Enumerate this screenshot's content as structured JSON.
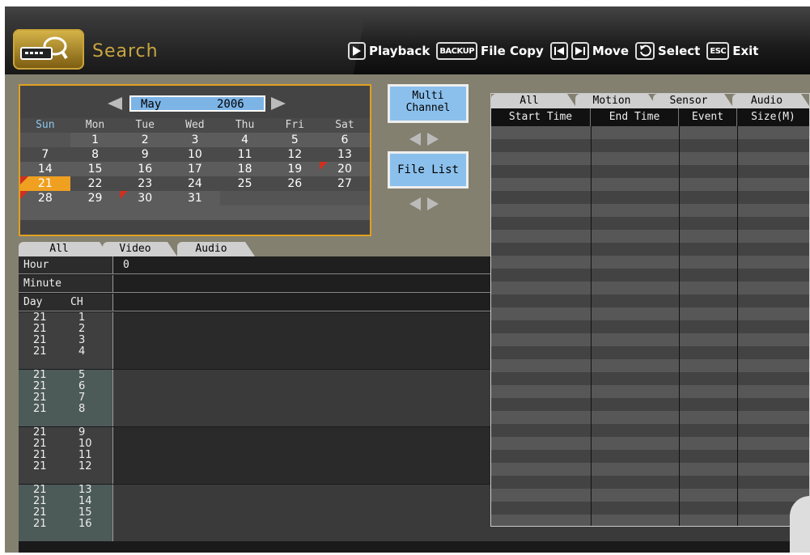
{
  "header": {
    "title": "Search",
    "legend": [
      {
        "icon": "play-icon",
        "label": "Playback"
      },
      {
        "icon": "backup-key-icon",
        "key": "BACKUP",
        "label": "File Copy"
      },
      {
        "icon": "skip-prev-icon",
        "label": ""
      },
      {
        "icon": "skip-next-icon",
        "label": "Move"
      },
      {
        "icon": "enter-icon",
        "label": "Select"
      },
      {
        "icon": "esc-key-icon",
        "key": "ESC",
        "label": "Exit"
      }
    ]
  },
  "calendar": {
    "month": "May",
    "year": "2006",
    "weekdays": [
      "Sun",
      "Mon",
      "Tue",
      "Wed",
      "Thu",
      "Fri",
      "Sat"
    ],
    "weeks": [
      [
        "",
        "1",
        "2",
        "3",
        "4",
        "5",
        "6"
      ],
      [
        "7",
        "8",
        "9",
        "10",
        "11",
        "12",
        "13"
      ],
      [
        "14",
        "15",
        "16",
        "17",
        "18",
        "19",
        "20"
      ],
      [
        "21",
        "22",
        "23",
        "24",
        "25",
        "26",
        "27"
      ],
      [
        "28",
        "29",
        "30",
        "31",
        "",
        "",
        ""
      ]
    ],
    "selected_day": "21",
    "recorded_days": [
      "20",
      "21",
      "28",
      "30"
    ],
    "colors": {
      "selected": "#f0a020",
      "month_bar": "#7cb4e6",
      "border": "#e0a020",
      "mark": "#d03020"
    }
  },
  "middle": {
    "multi_channel_line1": "Multi",
    "multi_channel_line2": "Channel",
    "file_list": "File List"
  },
  "left_tabs": [
    "All",
    "Video",
    "Audio"
  ],
  "timeline": {
    "hour_label": "Hour",
    "hour_value": "0",
    "minute_label": "Minute",
    "day_label": "Day",
    "ch_label": "CH",
    "rows": [
      {
        "day": "21",
        "ch": "1"
      },
      {
        "day": "21",
        "ch": "2"
      },
      {
        "day": "21",
        "ch": "3"
      },
      {
        "day": "21",
        "ch": "4"
      },
      {
        "day": "21",
        "ch": "5"
      },
      {
        "day": "21",
        "ch": "6"
      },
      {
        "day": "21",
        "ch": "7"
      },
      {
        "day": "21",
        "ch": "8"
      },
      {
        "day": "21",
        "ch": "9"
      },
      {
        "day": "21",
        "ch": "10"
      },
      {
        "day": "21",
        "ch": "11"
      },
      {
        "day": "21",
        "ch": "12"
      },
      {
        "day": "21",
        "ch": "13"
      },
      {
        "day": "21",
        "ch": "14"
      },
      {
        "day": "21",
        "ch": "15"
      },
      {
        "day": "21",
        "ch": "16"
      }
    ]
  },
  "event_list": {
    "tabs": [
      "All",
      "Motion",
      "Sensor",
      "Audio"
    ],
    "columns": [
      "Start Time",
      "End Time",
      "Event",
      "Size(M)"
    ]
  }
}
